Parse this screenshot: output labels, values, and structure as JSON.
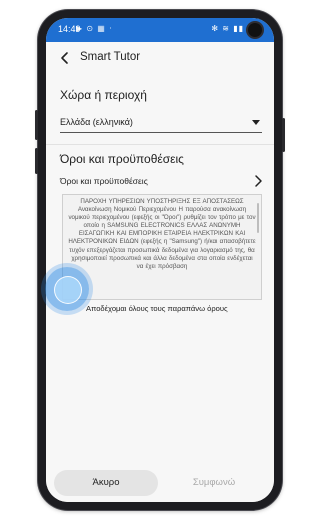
{
  "status_bar": {
    "time": "14:49",
    "left_icons": "▶ ⊙ ▦ ⋅",
    "right_icons": "✻ ≋ ▮▮"
  },
  "app_bar": {
    "title": "Smart Tutor",
    "back_icon": "arrow-left-icon"
  },
  "region": {
    "heading": "Χώρα ή περιοχή",
    "selected": "Ελλάδα (ελληνικά)"
  },
  "terms": {
    "heading": "Όροι και προϋποθέσεις",
    "link_label": "Όροι και προϋποθέσεις",
    "body": "ΠΑΡΟΧΗ ΥΠΗΡΕΣΙΩΝ ΥΠΟΣΤΗΡΙΞΗΣ ΕΞ ΑΠΟΣΤΑΣΕΩΣ Ανακοίνωση Νομικού Περιεχομένου Η παρούσα ανακοίνωση νομικού περιεχομένου (εφεξής οι \"Όροι\") ρυθμίζει τον τρόπο με τον οποίο η SAMSUNG ELECTRONICS ΕΛΛΑΣ ΑΝΩΝΥΜΗ ΕΙΣΑΓΩΓΙΚΗ ΚΑΙ ΕΜΠΟΡΙΚΗ ΕΤΑΙΡΕΙΑ ΗΛΕΚΤΡΙΚΩΝ ΚΑΙ ΗΛΕΚΤΡΟΝΙΚΩΝ ΕΙΔΩΝ (εφεξής η \"Samsung\") ή/και απασοβήτετε τυχόν επεξεργάζεται προσωπικά δεδομένα για λογαριασμό της, θα χρησιμοποιεί προσωπικά και άλλα δεδομένα στα οποία ενδέχεται να έχει πρόσβαση",
    "accept_label": "Αποδέχομαι όλους τους παραπάνω όρους",
    "accept_checked": false
  },
  "actions": {
    "cancel": "Άκυρο",
    "agree": "Συμφωνώ",
    "agree_enabled": false
  },
  "colors": {
    "status_bar": "#1f6fd1",
    "touch_indicator": "#308ce6"
  }
}
